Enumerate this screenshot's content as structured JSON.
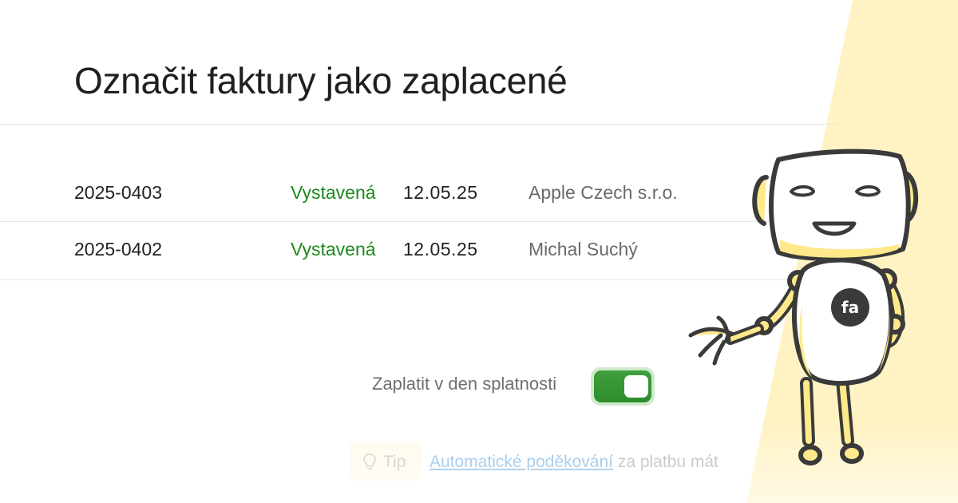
{
  "page": {
    "title": "Označit faktury jako zaplacené"
  },
  "invoices": [
    {
      "number": "2025-0403",
      "status": "Vystavená",
      "date": "12.05.25",
      "client": "Apple Czech s.r.o."
    },
    {
      "number": "2025-0402",
      "status": "Vystavená",
      "date": "12.05.25",
      "client": "Michal Suchý"
    }
  ],
  "payment": {
    "toggle_label": "Zaplatit v den splatnosti",
    "toggle_on": true
  },
  "tip": {
    "label": "Tip",
    "link_text": "Automatické poděkování",
    "text_after": " za platbu mát"
  },
  "mascot": {
    "logo_text": "fa"
  },
  "colors": {
    "status_green": "#1c8a1c",
    "toggle_green": "#3f9f3c",
    "accent_yellow": "#fff3c4",
    "link_blue": "#8bbde6"
  },
  "icons": [
    "lightbulb-icon"
  ]
}
